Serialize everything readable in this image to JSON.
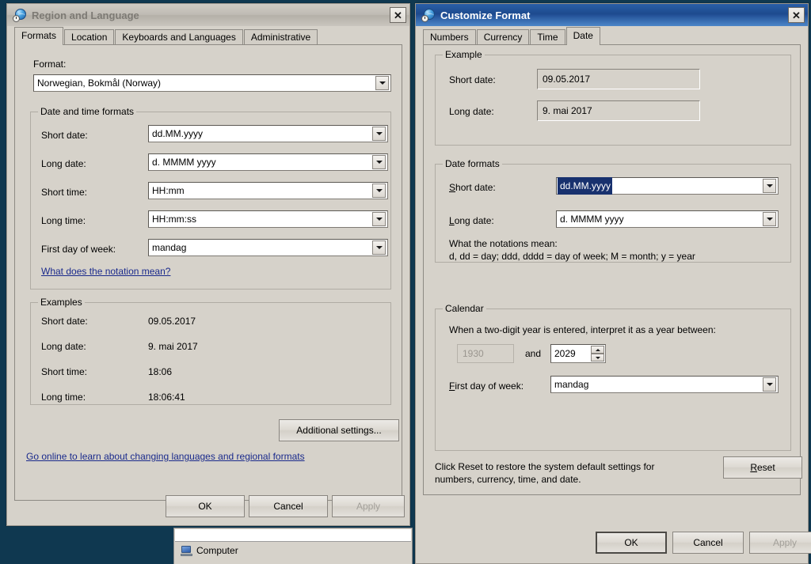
{
  "desktop": {
    "background_color": "#0f3850"
  },
  "background_window": {
    "item_label": "Computer",
    "icon": "computer-icon"
  },
  "region_window": {
    "title": "Region and Language",
    "title_icon": "globe-clock-icon",
    "close_label": "✕",
    "tabs": [
      {
        "label": "Formats",
        "selected": true
      },
      {
        "label": "Location",
        "selected": false
      },
      {
        "label": "Keyboards and Languages",
        "selected": false
      },
      {
        "label": "Administrative",
        "selected": false
      }
    ],
    "format_label": "Format:",
    "format_value": "Norwegian, Bokmål (Norway)",
    "datetime_group": {
      "title": "Date and time formats",
      "rows": [
        {
          "label": "Short date:",
          "value": "dd.MM.yyyy"
        },
        {
          "label": "Long date:",
          "value": "d. MMMM yyyy"
        },
        {
          "label": "Short time:",
          "value": "HH:mm"
        },
        {
          "label": "Long time:",
          "value": "HH:mm:ss"
        },
        {
          "label": "First day of week:",
          "value": "mandag"
        }
      ],
      "notation_link": "What does the notation mean?"
    },
    "examples_group": {
      "title": "Examples",
      "rows": [
        {
          "label": "Short date:",
          "value": "09.05.2017"
        },
        {
          "label": "Long date:",
          "value": "9. mai 2017"
        },
        {
          "label": "Short time:",
          "value": "18:06"
        },
        {
          "label": "Long time:",
          "value": "18:06:41"
        }
      ]
    },
    "additional_settings_label": "Additional settings...",
    "online_link": "Go online to learn about changing languages and regional formats",
    "buttons": {
      "ok": "OK",
      "cancel": "Cancel",
      "apply": "Apply"
    }
  },
  "customize_window": {
    "title": "Customize Format",
    "title_icon": "globe-clock-icon",
    "close_label": "✕",
    "tabs": [
      {
        "label": "Numbers",
        "selected": false
      },
      {
        "label": "Currency",
        "selected": false
      },
      {
        "label": "Time",
        "selected": false
      },
      {
        "label": "Date",
        "selected": true
      }
    ],
    "example_group": {
      "title": "Example",
      "rows": [
        {
          "label": "Short date:",
          "value": "09.05.2017"
        },
        {
          "label": "Long date:",
          "value": "9. mai 2017"
        }
      ]
    },
    "date_formats_group": {
      "title": "Date formats",
      "short_date_label": "Short date:",
      "short_date_accel": "S",
      "short_date_value": "dd.MM.yyyy",
      "long_date_label": "Long date:",
      "long_date_accel": "L",
      "long_date_value": "d. MMMM yyyy",
      "notations_heading": "What the notations mean:",
      "notations_text": "d, dd = day;  ddd, dddd = day of week;  M = month;  y = year"
    },
    "calendar_group": {
      "title": "Calendar",
      "two_digit_text": "When a two-digit year is entered, interpret it as a year between:",
      "year_from": "1930",
      "and_label": "and",
      "year_to": "2029",
      "first_day_label": "First day of week:",
      "first_day_accel": "F",
      "first_day_value": "mandag"
    },
    "reset_note_line1": "Click Reset to restore the system default settings for",
    "reset_note_line2": "numbers, currency, time, and date.",
    "reset_label": "Reset",
    "reset_accel": "R",
    "buttons": {
      "ok": "OK",
      "cancel": "Cancel",
      "apply": "Apply"
    }
  }
}
